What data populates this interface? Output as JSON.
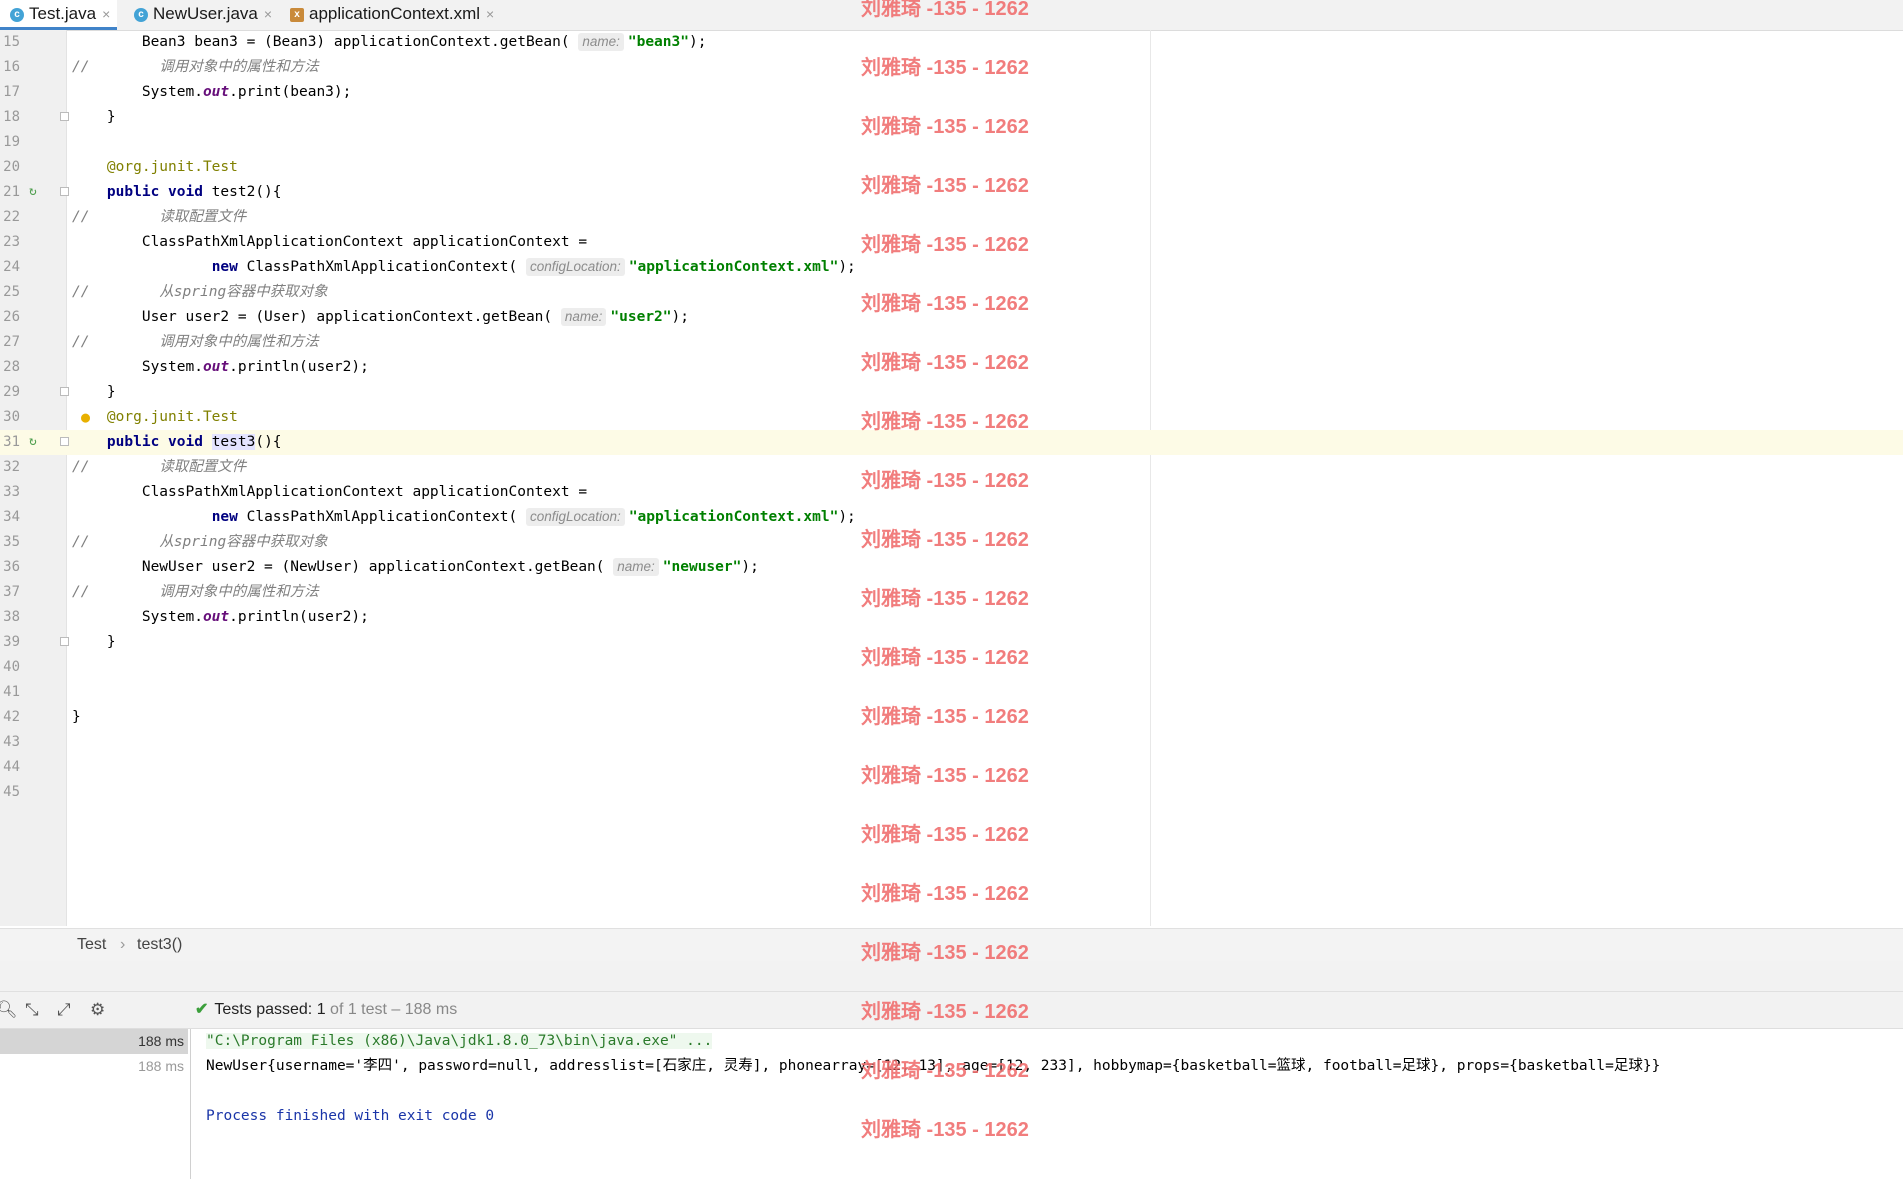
{
  "tabs": [
    {
      "label": "Test.java",
      "icon": "java-class-icon",
      "active": true
    },
    {
      "label": "NewUser.java",
      "icon": "java-class-icon",
      "active": false
    },
    {
      "label": "applicationContext.xml",
      "icon": "xml-file-icon",
      "active": false
    }
  ],
  "code_lines": [
    {
      "num": "15",
      "html": "        Bean3 bean3 = (Bean3) applicationContext.getBean( <span class=\"hint\">name:</span><span class=\"str\">\"bean3\"</span>);"
    },
    {
      "num": "16",
      "html": "<span class=\"cmt\">//        调用对象中的属性和方法</span>"
    },
    {
      "num": "17",
      "html": "        System.<span class=\"stat\">out</span>.print(bean3);"
    },
    {
      "num": "18",
      "html": "    }"
    },
    {
      "num": "19",
      "html": ""
    },
    {
      "num": "20",
      "html": "    <span class=\"ann\">@org.junit.Test</span>"
    },
    {
      "num": "21",
      "html": "    <span class=\"kw\">public void</span> test2(){"
    },
    {
      "num": "22",
      "html": "<span class=\"cmt\">//        读取配置文件</span>"
    },
    {
      "num": "23",
      "html": "        ClassPathXmlApplicationContext applicationContext ="
    },
    {
      "num": "24",
      "html": "                <span class=\"kw\">new</span> ClassPathXmlApplicationContext( <span class=\"hint\">configLocation:</span><span class=\"str\">\"applicationContext.xml\"</span>);"
    },
    {
      "num": "25",
      "html": "<span class=\"cmt\">//        从spring容器中获取对象</span>"
    },
    {
      "num": "26",
      "html": "        User user2 = (User) applicationContext.getBean( <span class=\"hint\">name:</span><span class=\"str\">\"user2\"</span>);"
    },
    {
      "num": "27",
      "html": "<span class=\"cmt\">//        调用对象中的属性和方法</span>"
    },
    {
      "num": "28",
      "html": "        System.<span class=\"stat\">out</span>.println(user2);"
    },
    {
      "num": "29",
      "html": "    }"
    },
    {
      "num": "30",
      "html": "    <span class=\"ann\">@org.junit.Test</span>"
    },
    {
      "num": "31",
      "html": "    <span class=\"kw\">public void</span> <span class=\"hl\">test3</span>(){"
    },
    {
      "num": "32",
      "html": "<span class=\"cmt\">//        读取配置文件</span>"
    },
    {
      "num": "33",
      "html": "        ClassPathXmlApplicationContext applicationContext ="
    },
    {
      "num": "34",
      "html": "                <span class=\"kw\">new</span> ClassPathXmlApplicationContext( <span class=\"hint\">configLocation:</span><span class=\"str\">\"applicationContext.xml\"</span>);"
    },
    {
      "num": "35",
      "html": "<span class=\"cmt\">//        从spring容器中获取对象</span>"
    },
    {
      "num": "36",
      "html": "        NewUser user2 = (NewUser) applicationContext.getBean( <span class=\"hint\">name:</span><span class=\"str\">\"newuser\"</span>);"
    },
    {
      "num": "37",
      "html": "<span class=\"cmt\">//        调用对象中的属性和方法</span>"
    },
    {
      "num": "38",
      "html": "        System.<span class=\"stat\">out</span>.println(user2);"
    },
    {
      "num": "39",
      "html": "    }"
    },
    {
      "num": "40",
      "html": ""
    },
    {
      "num": "41",
      "html": ""
    },
    {
      "num": "42",
      "html": "}"
    },
    {
      "num": "43",
      "html": ""
    },
    {
      "num": "44",
      "html": ""
    },
    {
      "num": "45",
      "html": ""
    }
  ],
  "breadcrumb": {
    "class": "Test",
    "method": "test3()"
  },
  "run": {
    "status_prefix": "Tests passed:",
    "passed_count": "1",
    "status_suffix": "of 1 test – 188 ms",
    "tree_rows": [
      "188 ms",
      "188 ms"
    ],
    "console": {
      "command": "\"C:\\Program Files (x86)\\Java\\jdk1.8.0_73\\bin\\java.exe\" ...",
      "output": "NewUser{username='李四', password=null, addresslist=[石家庄, 灵寿], phonearray=[12, 13], age=[12, 233], hobbymap={basketball=篮球, football=足球}, props={basketball=足球}}",
      "exit": "Process finished with exit code 0"
    }
  },
  "watermark_text": "刘雅琦 -135 - 1262",
  "colors": {
    "keyword": "#000080",
    "string": "#008000",
    "comment": "#808080",
    "annotation": "#808000",
    "watermark": "#f07070"
  }
}
